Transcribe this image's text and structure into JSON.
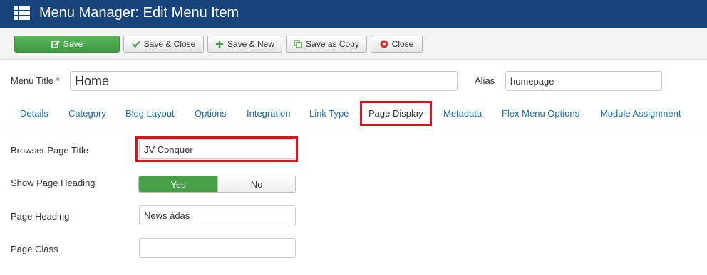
{
  "header": {
    "title": "Menu Manager: Edit Menu Item",
    "icon": "menu-grid-icon"
  },
  "toolbar": {
    "save": "Save",
    "save_close": "Save & Close",
    "save_new": "Save & New",
    "save_copy": "Save as Copy",
    "close": "Close"
  },
  "form": {
    "menu_title_label": "Menu Title *",
    "menu_title_value": "Home",
    "alias_label": "Alias",
    "alias_value": "homepage"
  },
  "tabs": [
    {
      "label": "Details"
    },
    {
      "label": "Category"
    },
    {
      "label": "Blog Layout"
    },
    {
      "label": "Options"
    },
    {
      "label": "Integration"
    },
    {
      "label": "Link Type"
    },
    {
      "label": "Page Display"
    },
    {
      "label": "Metadata"
    },
    {
      "label": "Flex Menu Options"
    },
    {
      "label": "Module Assignment"
    }
  ],
  "page_display": {
    "browser_title_label": "Browser Page Title",
    "browser_title_value": "JV Conquer",
    "show_heading_label": "Show Page Heading",
    "yes": "Yes",
    "no": "No",
    "show_heading_value": "Yes",
    "heading_label": "Page Heading",
    "heading_value": "News ádas",
    "class_label": "Page Class",
    "class_value": ""
  },
  "colors": {
    "header": "#17447a",
    "save": "#46a046",
    "highlight": "#e3101b",
    "link": "#1a6fb0"
  }
}
